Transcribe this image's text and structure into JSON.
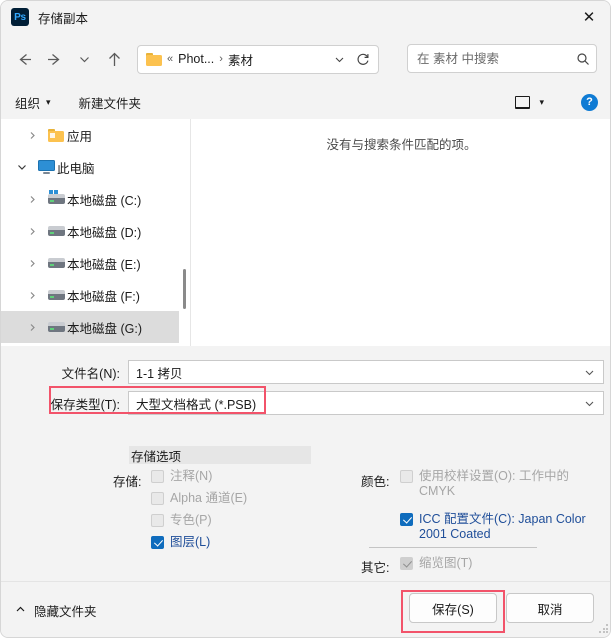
{
  "titlebar": {
    "app_icon": "photoshop-icon",
    "app_icon_text": "Ps",
    "title": "存储副本",
    "close_label": "✕"
  },
  "navbar": {
    "back_icon": "arrow-left-icon",
    "forward_icon": "arrow-right-icon",
    "recent_icon": "chevron-down-icon",
    "up_icon": "arrow-up-icon",
    "breadcrumb": {
      "folder_icon": "folder-icon",
      "overflow": "«",
      "separator": "›",
      "parent": "Phot...",
      "current": "素材",
      "chevron_icon": "chevron-down-icon",
      "refresh_icon": "refresh-icon"
    },
    "search": {
      "placeholder": "在 素材 中搜索",
      "value": "",
      "icon": "search-icon"
    }
  },
  "commandbar": {
    "organize_label": "组织",
    "organize_caret": "▾",
    "new_folder_label": "新建文件夹",
    "view_icon": "view-layout-icon",
    "view_caret": "▾",
    "help_label": "?"
  },
  "tree": {
    "items": [
      {
        "label": "应用",
        "icon": "folder-icon",
        "indent": 1,
        "expanded": false,
        "selected": false
      },
      {
        "label": "此电脑",
        "icon": "this-pc-icon",
        "indent": 1,
        "expanded": true,
        "selected": false
      },
      {
        "label": "本地磁盘 (C:)",
        "icon": "system-drive-icon",
        "indent": 2,
        "expanded": false,
        "selected": false
      },
      {
        "label": "本地磁盘 (D:)",
        "icon": "drive-icon",
        "indent": 2,
        "expanded": false,
        "selected": false
      },
      {
        "label": "本地磁盘 (E:)",
        "icon": "drive-icon",
        "indent": 2,
        "expanded": false,
        "selected": false
      },
      {
        "label": "本地磁盘 (F:)",
        "icon": "drive-icon",
        "indent": 2,
        "expanded": false,
        "selected": false
      },
      {
        "label": "本地磁盘 (G:)",
        "icon": "drive-icon",
        "indent": 2,
        "expanded": false,
        "selected": true
      }
    ]
  },
  "filelist": {
    "empty_message": "没有与搜索条件匹配的项。"
  },
  "fields": {
    "filename_label": "文件名(N):",
    "filename_value": "1-1 拷贝",
    "filetype_label": "保存类型(T):",
    "filetype_value": "大型文档格式 (*.PSB)",
    "chevron_icon": "chevron-down-icon"
  },
  "options": {
    "save_options_header": "存储选项",
    "save_label": "存储:",
    "checkboxes": [
      {
        "label": "注释(N)",
        "checked": false,
        "disabled": true
      },
      {
        "label": "Alpha 通道(E)",
        "checked": false,
        "disabled": true
      },
      {
        "label": "专色(P)",
        "checked": false,
        "disabled": true
      },
      {
        "label": "图层(L)",
        "checked": true,
        "disabled": false
      }
    ],
    "color_label": "颜色:",
    "proof_label": "使用校样设置(O): 工作中的 CMYK",
    "proof_checked": false,
    "proof_disabled": true,
    "icc_label": "ICC 配置文件(C): Japan Color 2001 Coated",
    "icc_checked": true,
    "icc_disabled": false,
    "other_label": "其它:",
    "thumbnail_label": "缩览图(T)",
    "thumbnail_checked": true,
    "thumbnail_disabled": true
  },
  "footer": {
    "hide_folders_icon": "chevron-up-icon",
    "hide_folders_label": "隐藏文件夹",
    "save_label": "保存(S)",
    "cancel_label": "取消"
  },
  "annotations": {
    "highlight_color": "#f2536a",
    "boxes": [
      "filetype-field",
      "save-button"
    ]
  },
  "colors": {
    "accent": "#0f6cbd",
    "link": "#1f4e99",
    "window_bg": "#f3f3f3",
    "content_bg": "#ffffff"
  }
}
